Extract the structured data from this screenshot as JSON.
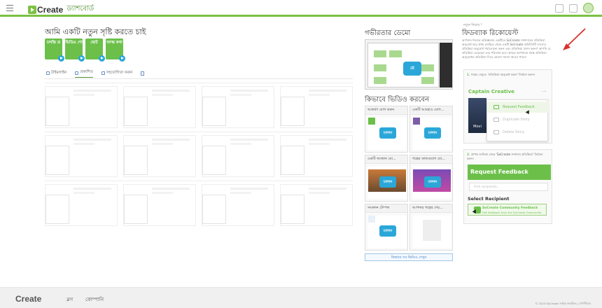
{
  "header": {
    "brand": "Create",
    "brand_sub": "ড্যাশবোর্ড",
    "accent_color": "#7bc142",
    "icons": [
      "hamburger-icon",
      "apps-icon",
      "community-icon",
      "avatar"
    ]
  },
  "create": {
    "title": "আমি একটি নতুন সৃষ্টি করতে চাই",
    "tiles": [
      "চলচ্চি ত্র",
      "ভিডিও শো",
      "ছোট",
      "আত্ম কথা"
    ]
  },
  "tabs": [
    {
      "label": "টাইমলাইন",
      "active": false
    },
    {
      "label": "প্রকাশিত",
      "active": true
    },
    {
      "label": "সহযোগিতা করুন",
      "active": false
    }
  ],
  "demo": {
    "title": "গভীরতার ডেমো",
    "play_label": "মে"
  },
  "howto": {
    "title": "কিভাবে ভিডিও করবেন",
    "videos": [
      {
        "title": "আকর্ষণ যোগ করুন",
        "play": "চালান"
      },
      {
        "title": "একটি আবহাও যোগ...",
        "play": "চালান"
      },
      {
        "title": "একটি অবস্থান যো...",
        "play": "চালান"
      },
      {
        "title": "গল্পের কাজগুলো যো...",
        "play": "চালান"
      },
      {
        "title": "সংকলন টেম্পল",
        "play": "চালান"
      },
      {
        "title": "আপনার গল্পের শেয়...",
        "play": ""
      }
    ],
    "see_all": "কিভাবে সব ভিডিও দেখুন"
  },
  "feedback": {
    "overline": "নতুন ফিচার !",
    "title": "ফিডব্যাক রিকোয়েস্ট",
    "description": "আপনার নিজের অভিজ্ঞতার একটিতে SoCreate সম্প্রদায়ের প্রতিক্রিয়া অনুরোধ করে প্রথম চলচ্চিত্র থেকে একটি SoCreate কমিউনিটি সদস্যের প্রতিক্রিয়া অনুরোধ পর্যালোচনা করুন এবং প্রতিক্রিয়া প্রদান করুন! আপনি যে প্রতিক্রিয়া চেয়েছেন তার পরিবর্তন হবে। আমরা আপনাকে সমস্ত প্রতিক্রিয়া অনুরোধের প্রতিক্রিয়া দিতে কোনো সমস্যা আরও পাবো।",
    "step1": "গল্পের মেনুতে 'প্রতিক্রিয়া অনুরোধ করুন' নির্বাচন করুন।",
    "step1_num": "1.",
    "story_title": "Captain Creative",
    "poster_label": "Movi",
    "menu": [
      {
        "label": "Request Feedback",
        "active": true
      },
      {
        "label": "Duplicate Story",
        "active": false
      },
      {
        "label": "Delete Story",
        "active": false
      }
    ],
    "step2": "প্রাপক তালিকা থেকে 'SoCreate সম্প্রদায় প্রতিক্রিয়া' নির্বাচন করুন।",
    "step2_num": "2.",
    "request_title": "Request Feedback",
    "recipient_placeholder": "Find recipients...",
    "select_recipient": "Select Recipient",
    "recipient_name": "SoCreate Community Feedback",
    "recipient_sub": "Get feedback from the SoCreate Community"
  },
  "footer": {
    "brand": "Create",
    "links": [
      "ব্লগ",
      "কোম্পানি"
    ],
    "copyright": "© 2023 SoCreate সর্বস্বত্ব সংরক্ষিত | গোপনীয়তা"
  }
}
